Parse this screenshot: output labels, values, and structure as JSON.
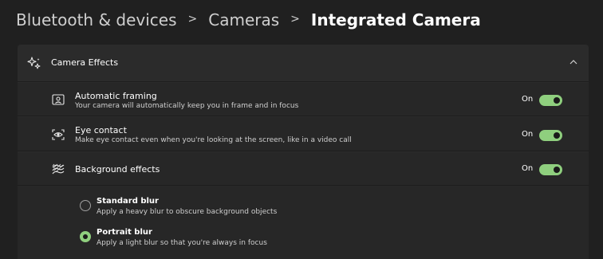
{
  "breadcrumb": {
    "items": [
      "Bluetooth & devices",
      "Cameras",
      "Integrated Camera"
    ],
    "separator": ">"
  },
  "section": {
    "title": "Camera Effects",
    "icon": "sparkle-icon",
    "expanded": true
  },
  "settings": [
    {
      "title": "Automatic framing",
      "description": "Your camera will automatically keep you in frame and in focus",
      "state": "On",
      "enabled": true,
      "icon": "person-frame-icon"
    },
    {
      "title": "Eye contact",
      "description": "Make eye contact even when you're looking at the screen, like in a video call",
      "state": "On",
      "enabled": true,
      "icon": "eye-camera-icon"
    },
    {
      "title": "Background effects",
      "state": "On",
      "enabled": true,
      "icon": "background-pattern-icon"
    }
  ],
  "background_options": [
    {
      "title": "Standard blur",
      "description": "Apply a heavy blur to obscure background objects",
      "selected": false
    },
    {
      "title": "Portrait blur",
      "description": "Apply a light blur so that you're always in focus",
      "selected": true
    }
  ],
  "colors": {
    "background": "#202020",
    "card": "#2b2b2b",
    "accent": "#8fcf7e"
  }
}
